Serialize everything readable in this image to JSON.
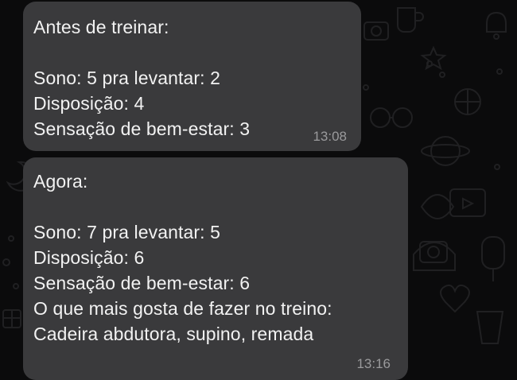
{
  "messages": [
    {
      "heading": "Antes de treinar:",
      "lines": [
        "Sono: 5 pra levantar: 2",
        "Disposição: 4",
        "Sensação de bem-estar: 3"
      ],
      "time": "13:08"
    },
    {
      "heading": "Agora:",
      "lines": [
        "Sono: 7 pra levantar: 5",
        "Disposição: 6",
        "Sensação de bem-estar: 6",
        "O que mais gosta de fazer no treino:",
        "Cadeira abdutora, supino, remada"
      ],
      "time": "13:16"
    }
  ],
  "colors": {
    "background": "#0b0b0c",
    "bubble": "#3a3a3c",
    "text": "#f2f2f2",
    "timestamp": "#9a9a9c",
    "doodle": "#1f1f21"
  }
}
